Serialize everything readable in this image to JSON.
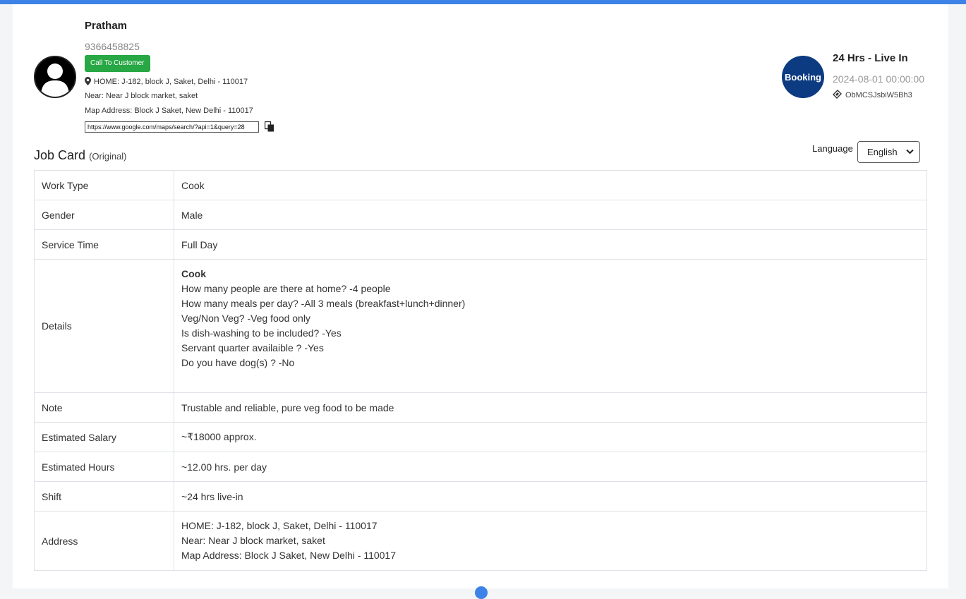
{
  "customer": {
    "name": "Pratham",
    "phone": "9366458825",
    "call_label": "Call To Customer",
    "address_home": "HOME: J-182, block J, Saket, Delhi - 110017",
    "address_near": "Near: Near J block market, saket",
    "address_map": "Map Address: Block J Saket, New Delhi - 110017",
    "map_url": "https://www.google.com/maps/search/?api=1&query=28"
  },
  "booking": {
    "logo_text": "Booking",
    "title": "24 Hrs - Live In",
    "date": "2024-08-01 00:00:00",
    "code": "ObMCSJsbiW5Bh3"
  },
  "job_card": {
    "title": "Job Card",
    "subtitle": "(Original)",
    "language_label": "Language",
    "language_selected": "English"
  },
  "rows": {
    "work_type": {
      "label": "Work Type",
      "value": "Cook"
    },
    "gender": {
      "label": "Gender",
      "value": "Male"
    },
    "service_time": {
      "label": "Service Time",
      "value": "Full Day"
    },
    "details": {
      "label": "Details",
      "heading": "Cook",
      "lines": [
        "How many people are there at home? -4 people",
        "How many meals per day? -All 3 meals (breakfast+lunch+dinner)",
        "Veg/Non Veg? -Veg food only",
        "Is dish-washing to be included? -Yes",
        "Servant quarter availaible ? -Yes",
        "Do you have dog(s) ? -No"
      ]
    },
    "note": {
      "label": "Note",
      "value": "Trustable and reliable, pure veg food to be made"
    },
    "salary": {
      "label": "Estimated Salary",
      "value": "~₹18000 approx."
    },
    "hours": {
      "label": "Estimated Hours",
      "value": "~12.00 hrs. per day"
    },
    "shift": {
      "label": "Shift",
      "value": "~24 hrs live-in"
    },
    "address": {
      "label": "Address",
      "lines": [
        "HOME: J-182, block J, Saket, Delhi - 110017",
        "Near: Near J block market, saket",
        "Map Address: Block J Saket, New Delhi - 110017"
      ]
    }
  },
  "colors": {
    "accent": "#3d82e6",
    "call_button": "#28a745",
    "booking_logo": "#0d3b82"
  }
}
